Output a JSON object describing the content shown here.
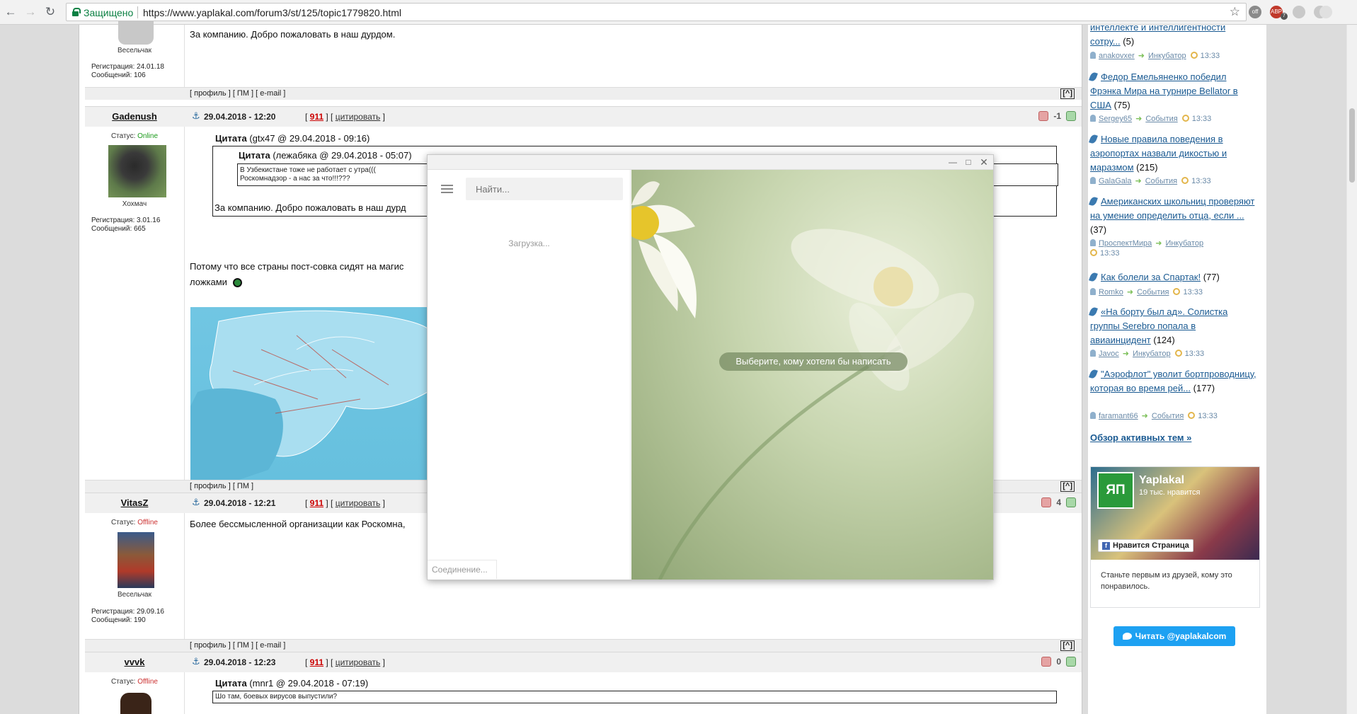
{
  "browser": {
    "secure_label": "Защищено",
    "url": "https://www.yaplakal.com/forum3/st/125/topic1779820.html",
    "ext_badges": [
      "off",
      "ABP",
      "7"
    ]
  },
  "posts": [
    {
      "rank": "Весельчак",
      "reg": "Регистрация: 24.01.18",
      "count": "Сообщений: 106",
      "text": "За компанию. Добро пожаловать в наш дурдом.",
      "links": "[ профиль ] [ ПМ ] [ e-mail ]"
    },
    {
      "nick": "Gadenush",
      "date": "29.04.2018 - 12:20",
      "n911": "911",
      "cite": "цитировать",
      "rating": "-1",
      "status_label": "Статус:",
      "status": "Online",
      "rank": "Хохмач",
      "reg": "Регистрация: 3.01.16",
      "count": "Сообщений: 665",
      "quote1_title": "Цитата",
      "quote1_meta": "(gtx47 @ 29.04.2018 - 09:16)",
      "quote2_title": "Цитата",
      "quote2_meta": "(лежабяка @ 29.04.2018 - 05:07)",
      "quote2_line1": "В Узбекистане тоже не работает с утра(((",
      "quote2_line2": "Роскомнадзор - а нас за что!!!???",
      "quote1_text": "За компанию. Добро пожаловать в наш дурд",
      "text1": "Потому что все страны пост-совка сидят на магис",
      "text2": "ложками",
      "links": "[ профиль ] [ ПМ ]"
    },
    {
      "nick": "VitasZ",
      "date": "29.04.2018 - 12:21",
      "n911": "911",
      "cite": "цитировать",
      "rating": "4",
      "status_label": "Статус:",
      "status": "Offline",
      "rank": "Весельчак",
      "reg": "Регистрация: 29.09.16",
      "count": "Сообщений: 190",
      "text": "Более бессмысленной организации как Роскомна,",
      "links": "[ профиль ] [ ПМ ] [ e-mail ]"
    },
    {
      "nick": "vvvk",
      "date": "29.04.2018 - 12:23",
      "n911": "911",
      "cite": "цитировать",
      "rating": "0",
      "status_label": "Статус:",
      "status": "Offline",
      "quote_title": "Цитата",
      "quote_meta": "(mnr1 @ 29.04.2018 - 07:19)",
      "quote_text": "Шо там, боевых вирусов выпустили?"
    }
  ],
  "up_label": "[^]",
  "sidebar": {
    "topics": [
      {
        "title": "интеллекте и интеллигентности сотру...",
        "count": "(5)",
        "author": "anakovxer",
        "section": "Инкубатор",
        "time": "13:33"
      },
      {
        "title": "Федор Емельяненко победил Фрэнка Мира на турнире Bellator в США",
        "count": "(75)",
        "author": "Sergey65",
        "section": "События",
        "time": "13:33"
      },
      {
        "title": "Новые правила поведения в аэропортах назвали дикостью и маразмом",
        "count": "(215)",
        "author": "GalaGala",
        "section": "События",
        "time": "13:33"
      },
      {
        "title": "Американских школьниц проверяют на умение определить отца, если ...",
        "count": "(37)",
        "author": "ПроспектМира",
        "section": "Инкубатор",
        "time": "13:33"
      },
      {
        "title": "Как болели за Спартак!",
        "count": "(77)",
        "author": "Romko",
        "section": "События",
        "time": "13:33"
      },
      {
        "title": "«На борту был ад». Солистка группы Serebro попала в авиаинцидент",
        "count": "(124)",
        "author": "Javoc",
        "section": "Инкубатор",
        "time": "13:33"
      },
      {
        "title": "\"Аэрофлот\" уволит бортпроводницу, которая во время рей...",
        "count": "(177)",
        "author": "faramant66",
        "section": "События",
        "time": "13:33"
      }
    ],
    "overview": "Обзор активных тем »",
    "fb": {
      "logo": "ЯП",
      "name": "Yaplakal",
      "likes": "19 тыс. нравится",
      "like_button": "Нравится Страница",
      "text": "Станьте первым из друзей, кому это понравилось."
    },
    "twitter": "Читать @yaplakalcom"
  },
  "messenger": {
    "search_placeholder": "Найти...",
    "loading": "Загрузка...",
    "connecting": "Соединение...",
    "choose": "Выберите, кому хотели бы написать"
  }
}
